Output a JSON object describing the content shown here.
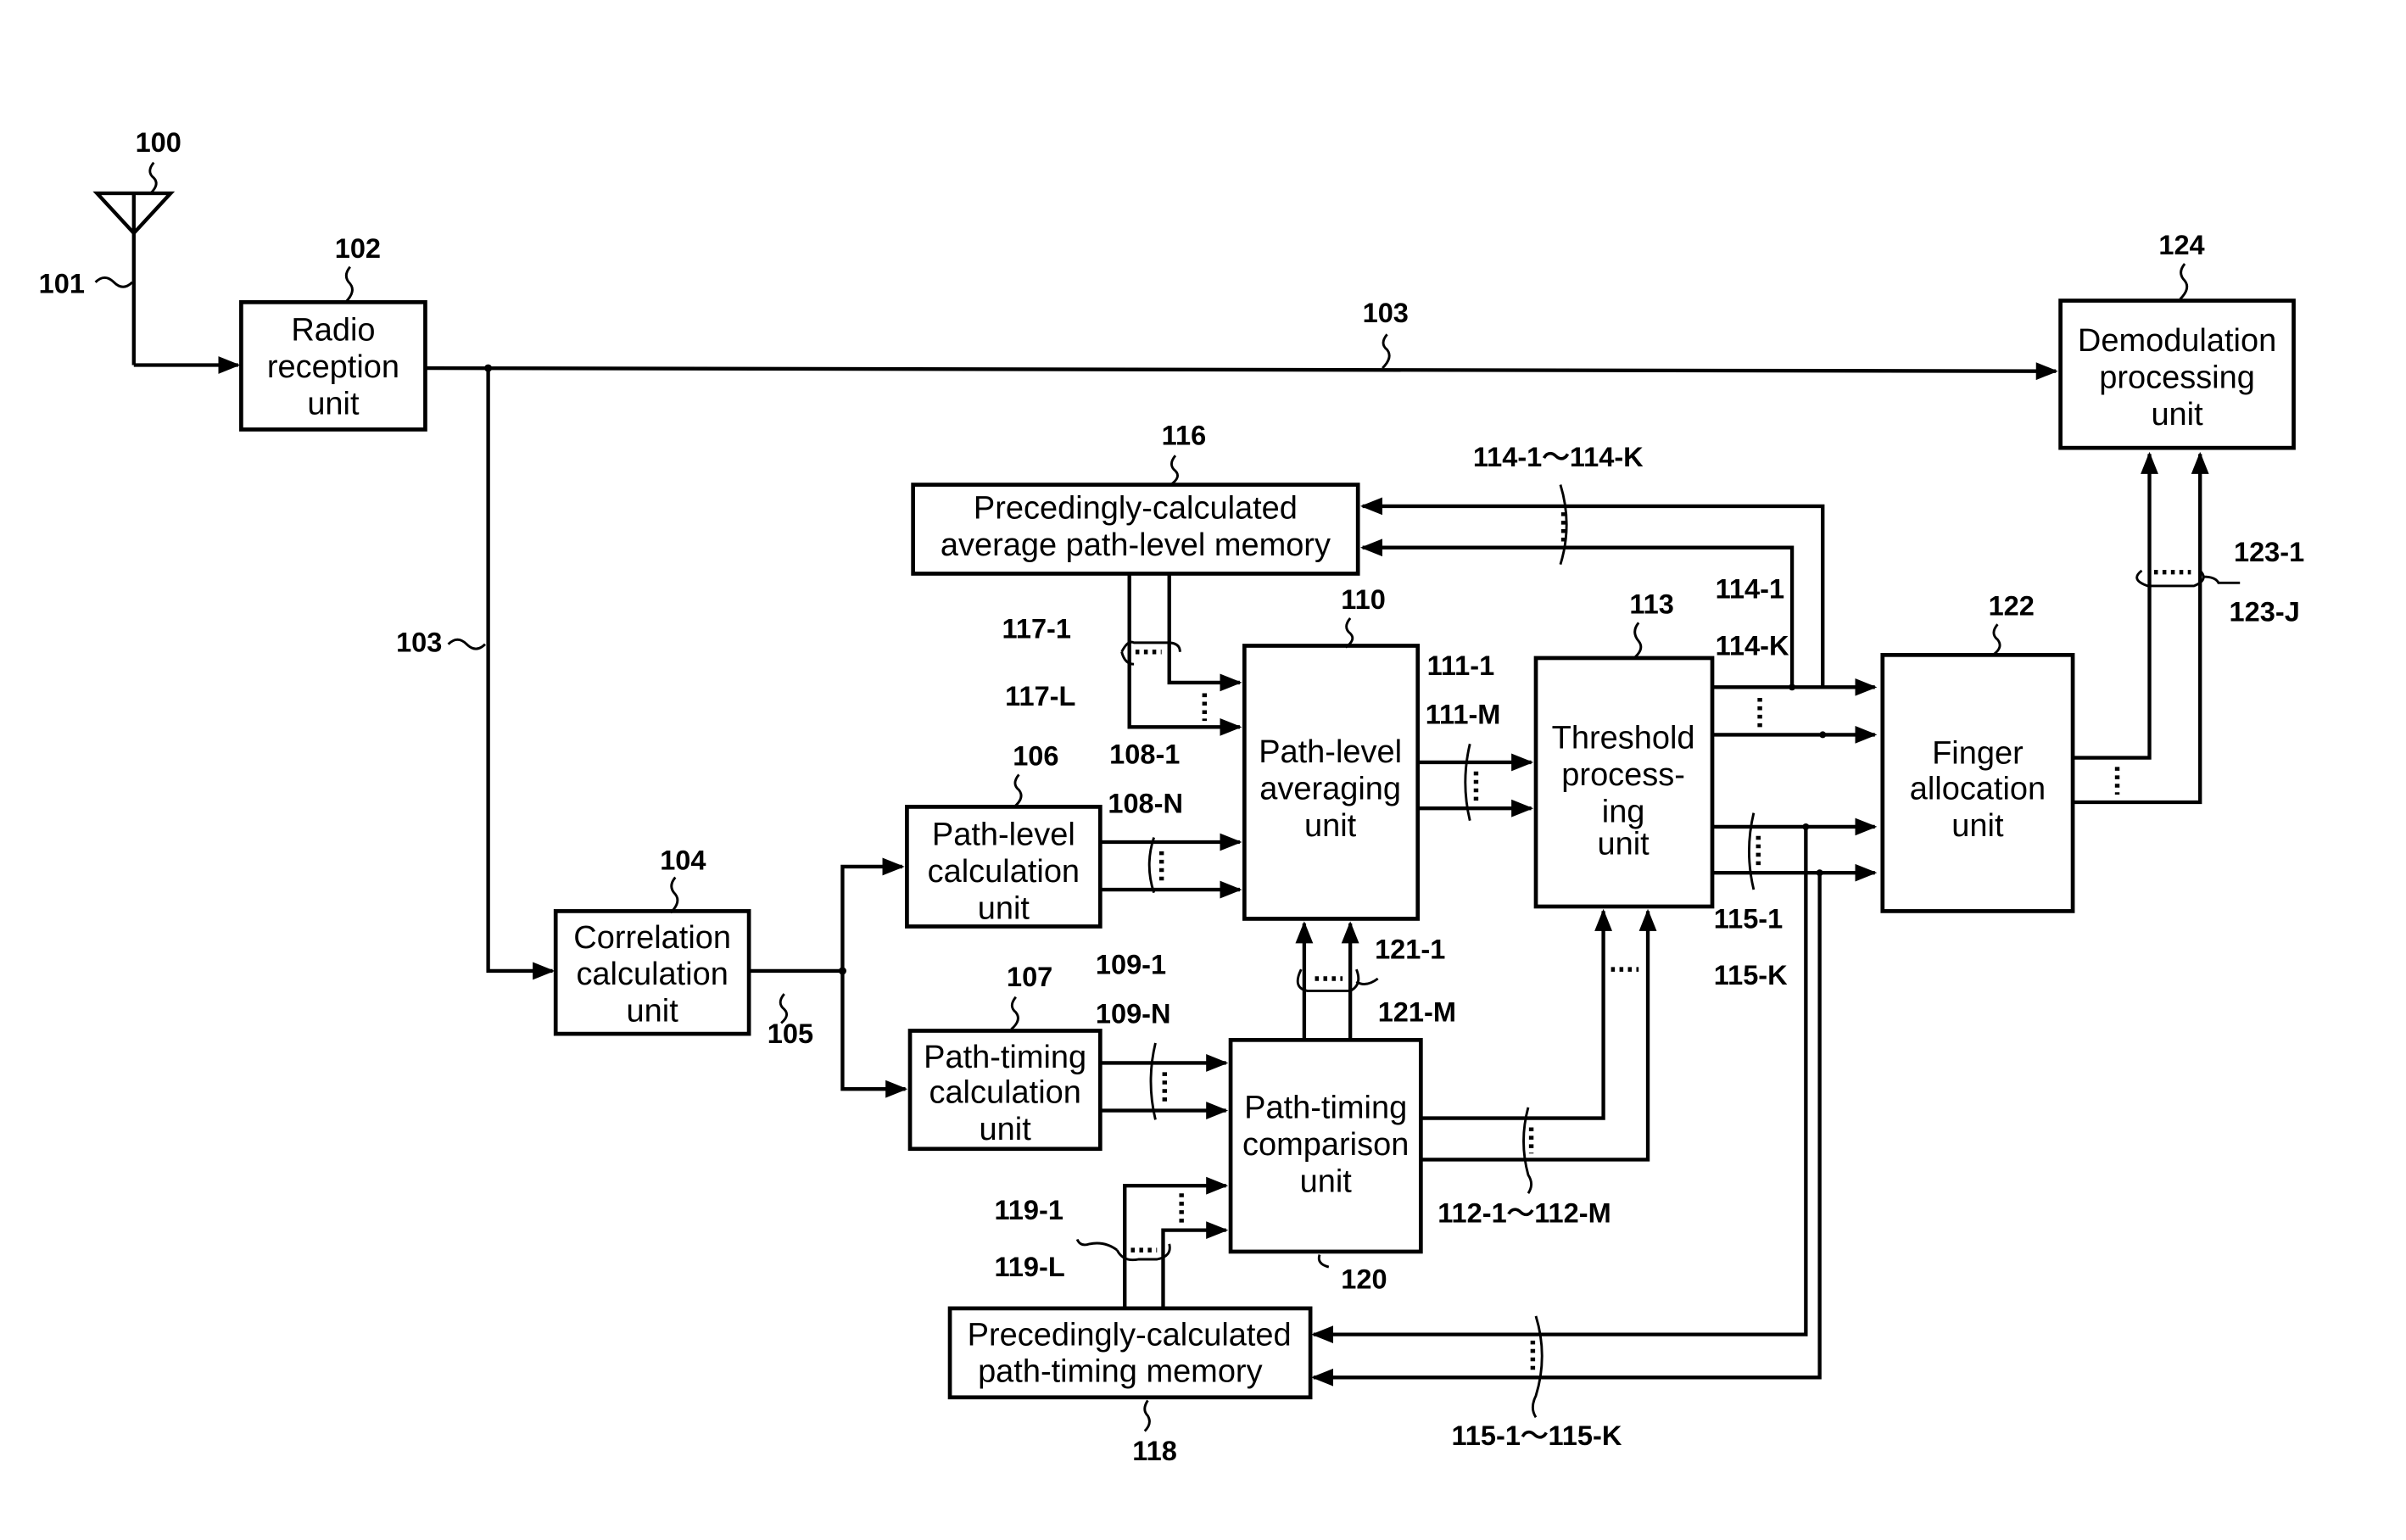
{
  "diagram": {
    "type": "block-diagram",
    "colors": {
      "stroke": "#000000",
      "background": "#ffffff"
    },
    "blocks": [
      {
        "id": "102",
        "ref": "102",
        "lines": [
          "Radio",
          "reception",
          "unit"
        ]
      },
      {
        "id": "104",
        "ref": "104",
        "lines": [
          "Correlation",
          "calculation",
          "unit"
        ]
      },
      {
        "id": "106",
        "ref": "106",
        "lines": [
          "Path-level",
          "calculation",
          "unit"
        ]
      },
      {
        "id": "107",
        "ref": "107",
        "lines": [
          "Path-timing",
          "calculation",
          "unit"
        ]
      },
      {
        "id": "110",
        "ref": "110",
        "lines": [
          "Path-level",
          "averaging",
          "unit"
        ]
      },
      {
        "id": "113",
        "ref": "113",
        "lines": [
          "Threshold",
          "process-",
          "ing",
          "unit"
        ]
      },
      {
        "id": "116",
        "ref": "116",
        "lines": [
          "Precedingly-calculated",
          "average path-level memory"
        ]
      },
      {
        "id": "118",
        "ref": "118",
        "lines": [
          "Precedingly-calculated",
          "path-timing memory"
        ]
      },
      {
        "id": "120",
        "ref": "120",
        "lines": [
          "Path-timing",
          "comparison",
          "unit"
        ]
      },
      {
        "id": "122",
        "ref": "122",
        "lines": [
          "Finger",
          "allocation",
          "unit"
        ]
      },
      {
        "id": "124",
        "ref": "124",
        "lines": [
          "Demodulation",
          "processing",
          "unit"
        ]
      }
    ],
    "antenna_ref": "100",
    "signal_labels": {
      "s101": "101",
      "s103a": "103",
      "s103b": "103",
      "s105": "105",
      "s108a": "108-1",
      "s108b": "108-N",
      "s109a": "109-1",
      "s109b": "109-N",
      "s111a": "111-1",
      "s111b": "111-M",
      "s112": "112-1～112-M",
      "s114top": "114-1～114-K",
      "s114a": "114-1",
      "s114b": "114-K",
      "s115a": "115-1",
      "s115b": "115-K",
      "s115bot": "115-1～115-K",
      "s117a": "117-1",
      "s117b": "117-L",
      "s119a": "119-1",
      "s119b": "119-L",
      "s121a": "121-1",
      "s121b": "121-M",
      "s123a": "123-1",
      "s123b": "123-J"
    },
    "tilde": "~",
    "ellipsis": "....",
    "approx": "≀"
  }
}
